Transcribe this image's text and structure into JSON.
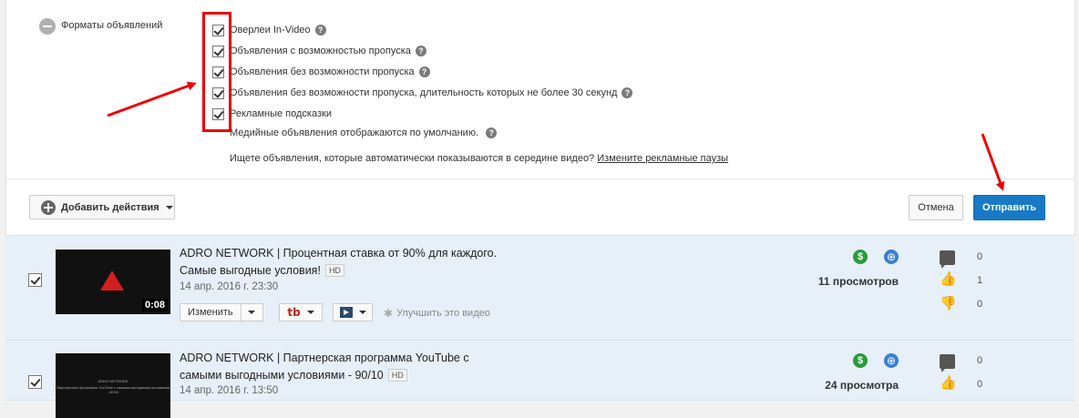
{
  "ad_formats": {
    "section_label": "Форматы объявлений",
    "options": [
      {
        "label": "Оверлеи In-Video",
        "checked": true
      },
      {
        "label": "Объявления с возможностью пропуска",
        "checked": true
      },
      {
        "label": "Объявления без возможности пропуска",
        "checked": true
      },
      {
        "label": "Объявления без возможности пропуска, длительность которых не более 30 секунд",
        "checked": true
      },
      {
        "label": "Рекламные подсказки",
        "checked": true
      }
    ],
    "media_note": "Медийные объявления отображаются по умолчанию.",
    "midroll_question": "Ищете объявления, которые автоматически показываются в середине видео?",
    "midroll_link": "Измените рекламные паузы",
    "help_glyph": "?"
  },
  "actions": {
    "add_actions": "Добавить действия",
    "cancel": "Отмена",
    "submit": "Отправить"
  },
  "videos": [
    {
      "title_line1": "ADRO NETWORK | Процентная ставка от 90% для каждого.",
      "title_line2": "Самые выгодные условия!",
      "hd": "HD",
      "date": "14 апр. 2016 г. 23:30",
      "duration": "0:08",
      "edit": "Изменить",
      "improve": "Улучшить это видео",
      "views": "11 просмотров",
      "comments": "0",
      "likes": "1",
      "dislikes": "0"
    },
    {
      "title_line1": "ADRO NETWORK | Партнерская программа YouTube с",
      "title_line2": "самыми выгодными условиями - 90/10",
      "hd": "HD",
      "date": "14 апр. 2016 г. 13:50",
      "thumb_text_1": "ADRO NETWORK",
      "thumb_text_2": "Партнерская программа YouTube с самыми выгодными условиями - 90/10",
      "views": "24 просмотра",
      "comments": "0",
      "likes": "0"
    }
  ],
  "icons": {
    "dollar": "$",
    "globe": "⊕",
    "like": "👍",
    "dislike": "👎",
    "sparkle": "✱"
  },
  "colors": {
    "accent": "#167ac6",
    "annotation": "#e00000",
    "monetization": "#2c9a3d",
    "row_bg": "#e7f0f8"
  }
}
